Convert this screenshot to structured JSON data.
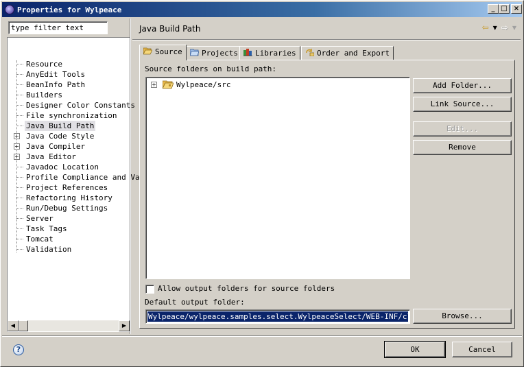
{
  "window": {
    "title": "Properties for Wylpeace",
    "minimize": "_",
    "maximize": "□",
    "close": "×"
  },
  "left": {
    "filter_value": "type filter text",
    "tree_items": [
      {
        "label": "Resource",
        "expandable": false,
        "selected": false
      },
      {
        "label": "AnyEdit Tools",
        "expandable": false,
        "selected": false
      },
      {
        "label": "BeanInfo Path",
        "expandable": false,
        "selected": false
      },
      {
        "label": "Builders",
        "expandable": false,
        "selected": false
      },
      {
        "label": "Designer Color Constants",
        "expandable": false,
        "selected": false
      },
      {
        "label": "File synchronization",
        "expandable": false,
        "selected": false
      },
      {
        "label": "Java Build Path",
        "expandable": false,
        "selected": true
      },
      {
        "label": "Java Code Style",
        "expandable": true,
        "selected": false
      },
      {
        "label": "Java Compiler",
        "expandable": true,
        "selected": false
      },
      {
        "label": "Java Editor",
        "expandable": true,
        "selected": false
      },
      {
        "label": "Javadoc Location",
        "expandable": false,
        "selected": false
      },
      {
        "label": "Profile Compliance and Va",
        "expandable": false,
        "selected": false
      },
      {
        "label": "Project References",
        "expandable": false,
        "selected": false
      },
      {
        "label": "Refactoring History",
        "expandable": false,
        "selected": false
      },
      {
        "label": "Run/Debug Settings",
        "expandable": false,
        "selected": false
      },
      {
        "label": "Server",
        "expandable": false,
        "selected": false
      },
      {
        "label": "Task Tags",
        "expandable": false,
        "selected": false
      },
      {
        "label": "Tomcat",
        "expandable": false,
        "selected": false
      },
      {
        "label": "Validation",
        "expandable": false,
        "selected": false
      }
    ]
  },
  "page": {
    "title": "Java Build Path",
    "tabs": [
      {
        "label": "Source",
        "icon": "folder-open-icon",
        "active": true
      },
      {
        "label": "Projects",
        "icon": "projects-icon",
        "active": false
      },
      {
        "label": "Libraries",
        "icon": "libraries-icon",
        "active": false
      },
      {
        "label": "Order and Export",
        "icon": "order-export-icon",
        "active": false
      }
    ],
    "source_label": "Source folders on build path:",
    "source_folders": [
      "Wylpeace/src"
    ],
    "buttons": {
      "add_folder": "Add Folder...",
      "link_source": "Link Source...",
      "edit": "Edit...",
      "remove": "Remove",
      "browse": "Browse..."
    },
    "allow_output_label": "Allow output folders for source folders",
    "default_output_label": "Default output folder:",
    "default_output_value": "Wylpeace/wylpeace.samples.select.WylpeaceSelect/WEB-INF/classes"
  },
  "footer": {
    "ok": "OK",
    "cancel": "Cancel"
  },
  "colors": {
    "title_bar": "#0a246a",
    "selection": "#0a246a",
    "dialog_bg": "#d4d0c8"
  }
}
